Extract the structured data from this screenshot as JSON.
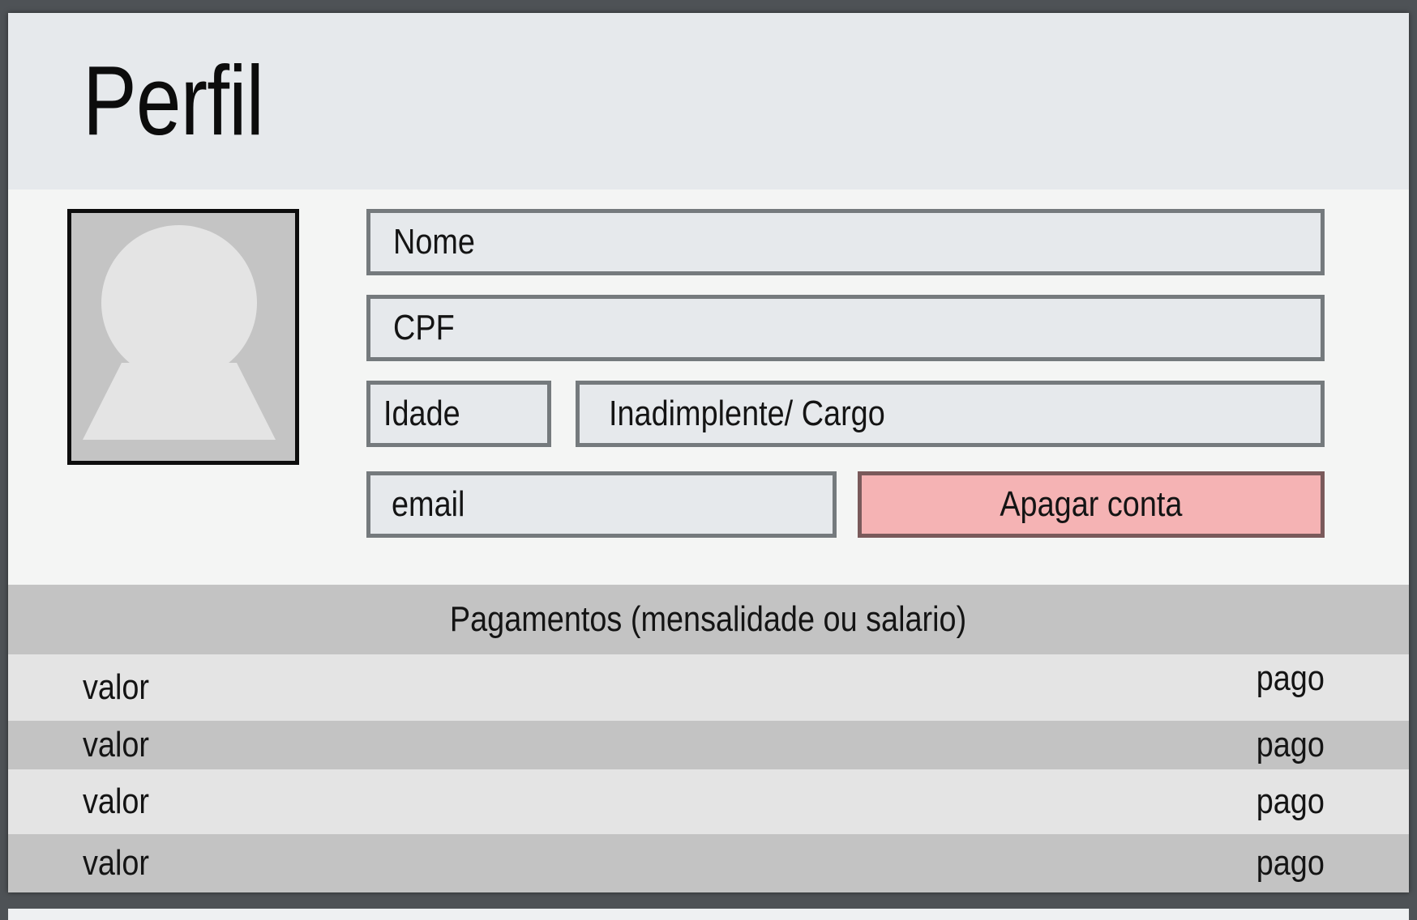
{
  "header": {
    "title": "Perfil"
  },
  "profile": {
    "name_label": "Nome",
    "cpf_label": "CPF",
    "age_label": "Idade",
    "status_label": "Inadimplente/ Cargo",
    "email_label": "email",
    "delete_label": "Apagar conta"
  },
  "payments": {
    "title": "Pagamentos (mensalidade ou salario)",
    "rows": [
      {
        "amount": "valor",
        "status": "pago"
      },
      {
        "amount": "valor",
        "status": "pago"
      },
      {
        "amount": "valor",
        "status": "pago"
      },
      {
        "amount": "valor",
        "status": "pago"
      }
    ]
  },
  "colors": {
    "header_bg": "#e6e9ec",
    "delete_bg": "#f5b3b4",
    "row_light": "#e4e4e4",
    "row_dark": "#c3c3c3"
  },
  "icons": {
    "avatar": "user-silhouette-icon"
  }
}
